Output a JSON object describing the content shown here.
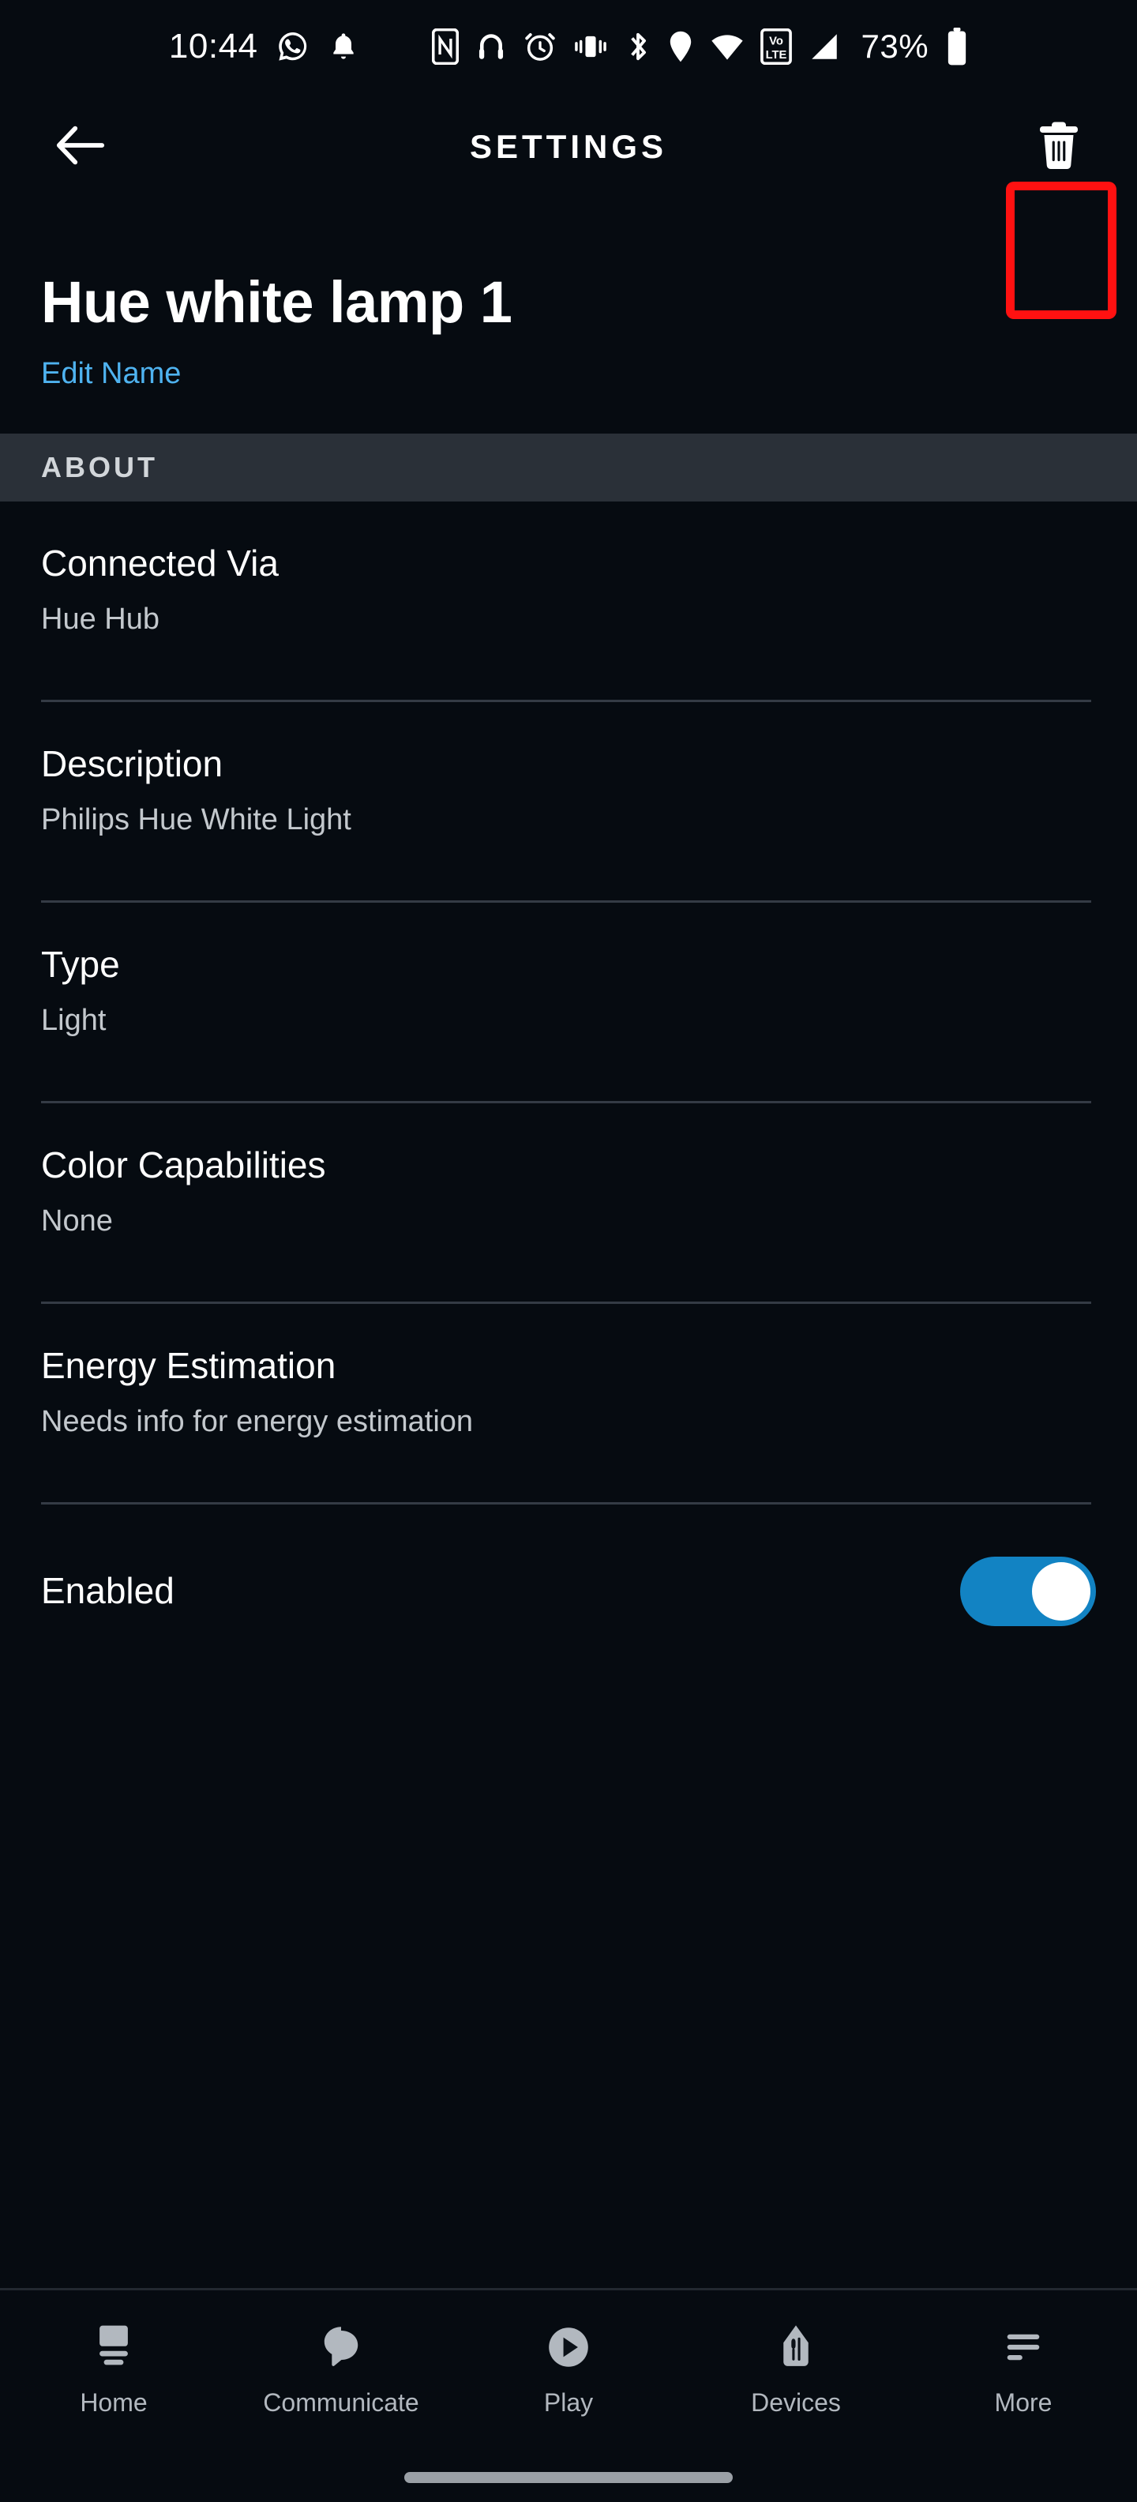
{
  "status_bar": {
    "time": "10:44",
    "battery_percent": "73%",
    "left_icons": [
      "whatsapp-icon",
      "notification-bell-icon"
    ],
    "right_icons": [
      "nfc-icon",
      "headphones-icon",
      "alarm-icon",
      "vibrate-icon",
      "bluetooth-icon",
      "location-icon",
      "wifi-icon",
      "volte-icon",
      "cellular-signal-icon",
      "battery-icon"
    ],
    "volte_label_top": "Vo",
    "volte_label_bottom": "LTE"
  },
  "appbar": {
    "title": "SETTINGS",
    "back_icon": "back-arrow-icon",
    "delete_icon": "trash-icon",
    "highlight_color": "#ff1111"
  },
  "device": {
    "name": "Hue white lamp 1",
    "edit_name_label": "Edit Name",
    "edit_name_color": "#4fb3f0"
  },
  "about_section": {
    "header": "ABOUT",
    "rows": [
      {
        "title": "Connected Via",
        "value": "Hue Hub"
      },
      {
        "title": "Description",
        "value": "Philips Hue White Light"
      },
      {
        "title": "Type",
        "value": "Light"
      },
      {
        "title": "Color Capabilities",
        "value": "None"
      },
      {
        "title": "Energy Estimation",
        "value": "Needs info for energy estimation"
      }
    ],
    "toggle_row": {
      "title": "Enabled",
      "state": "on",
      "accent_color": "#1283c3"
    }
  },
  "bottom_nav": {
    "items": [
      {
        "label": "Home",
        "icon": "echo-show-home-icon"
      },
      {
        "label": "Communicate",
        "icon": "speech-bubble-icon"
      },
      {
        "label": "Play",
        "icon": "play-circle-icon"
      },
      {
        "label": "Devices",
        "icon": "light-bulb-devices-icon"
      },
      {
        "label": "More",
        "icon": "hamburger-more-icon"
      }
    ]
  }
}
